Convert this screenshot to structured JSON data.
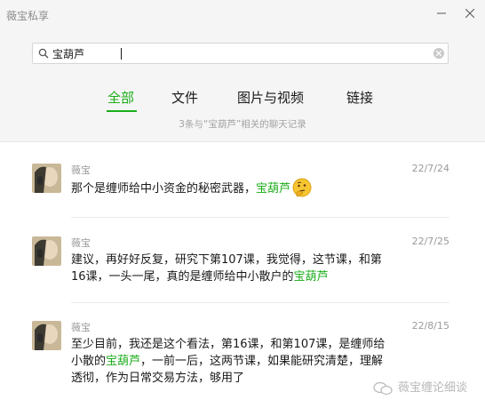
{
  "window": {
    "title": "薇宝私享",
    "min_icon": "minimize-icon",
    "close_icon": "close-icon"
  },
  "search": {
    "value": "宝葫芦",
    "icon": "search-icon",
    "clear_icon": "clear-icon"
  },
  "tabs": [
    {
      "label": "全部",
      "active": true
    },
    {
      "label": "文件",
      "active": false
    },
    {
      "label": "图片与视频",
      "active": false
    },
    {
      "label": "链接",
      "active": false
    }
  ],
  "summary": "3条与“宝葫芦”相关的聊天记录",
  "colors": {
    "accent": "#1aad19",
    "bg_header": "#f5f5f5"
  },
  "results": [
    {
      "sender": "薇宝",
      "date": "22/7/24",
      "segments": [
        {
          "text": "那个是缠师给中小资金的秘密武器，",
          "hl": false
        },
        {
          "text": "宝葫芦",
          "hl": true
        }
      ],
      "emoji": "thinking-face-icon"
    },
    {
      "sender": "薇宝",
      "date": "22/7/25",
      "segments": [
        {
          "text": "建议，再好好反复，研究下第107课，我觉得，这节课，和第16课，一头一尾，真的是缠师给中小散户的",
          "hl": false
        },
        {
          "text": "宝葫芦",
          "hl": true
        }
      ]
    },
    {
      "sender": "薇宝",
      "date": "22/8/15",
      "segments": [
        {
          "text": "至少目前，我还是这个看法，第16课，和第107课，是缠师给小散的",
          "hl": false
        },
        {
          "text": "宝葫芦",
          "hl": true
        },
        {
          "text": "，一前一后，这两节课，如果能研究清楚，理解透彻，作为日常交易方法，够用了",
          "hl": false
        }
      ]
    }
  ],
  "watermark": "薇宝缠论细谈"
}
